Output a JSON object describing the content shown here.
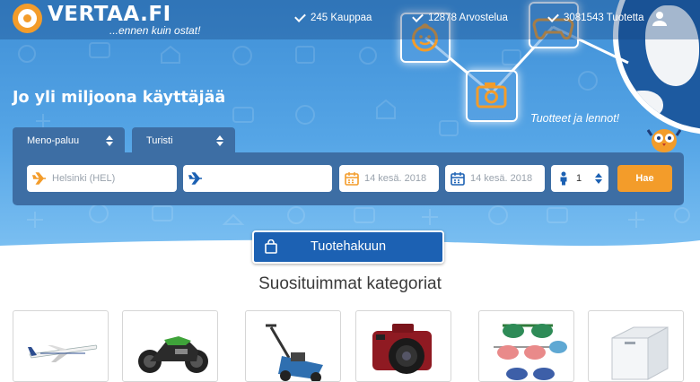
{
  "brand": {
    "name": "VERTAA.FI",
    "tagline": "...ennen kuin ostat!",
    "accent_color": "#f39c2a",
    "primary_color": "#1c61b3"
  },
  "header": {
    "stats": [
      {
        "icon": "check-icon",
        "label": "245 Kauppaa"
      },
      {
        "icon": "check-icon",
        "label": "12878 Arvostelua"
      },
      {
        "icon": "check-icon",
        "label": "3081543 Tuotetta"
      }
    ],
    "user_icon": "user-icon"
  },
  "hero": {
    "headline": "Jo yli miljoona käyttäjää",
    "note": "Tuotteet ja lennot!",
    "tiles": [
      "baby-face-icon",
      "camera-icon",
      "gamepad-icon"
    ]
  },
  "flight_search": {
    "trip_type": "Meno-paluu",
    "cabin_class": "Turisti",
    "origin_placeholder": "Helsinki (HEL)",
    "destination_placeholder": "",
    "depart_date": "14 kesä. 2018",
    "return_date": "14 kesä. 2018",
    "passengers": "1",
    "submit_label": "Hae"
  },
  "product_search": {
    "label": "Tuotehakuun",
    "icon": "shopping-bag-icon"
  },
  "categories": {
    "title": "Suosituimmat kategoriat",
    "items": [
      {
        "icon": "airplane-image"
      },
      {
        "icon": "motorcycle-image"
      },
      {
        "icon": "lawn-mower-image"
      },
      {
        "icon": "camera-image"
      },
      {
        "icon": "sunglasses-image"
      },
      {
        "icon": "chest-freezer-image"
      }
    ]
  }
}
